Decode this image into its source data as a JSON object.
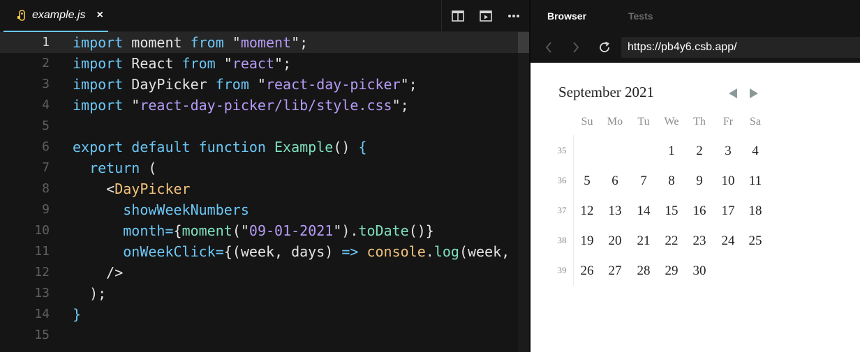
{
  "editor": {
    "tab": {
      "title": "example.js",
      "close": "×"
    },
    "toolbar_icons": [
      "split-view-icon",
      "preview-icon",
      "more-icon"
    ],
    "lines": [
      {
        "n": "1",
        "tokens": [
          {
            "t": "import",
            "c": "kw"
          },
          {
            "t": " moment ",
            "c": ""
          },
          {
            "t": "from",
            "c": "kw"
          },
          {
            "t": " \"",
            "c": "q"
          },
          {
            "t": "moment",
            "c": "str"
          },
          {
            "t": "\";",
            "c": "q"
          }
        ]
      },
      {
        "n": "2",
        "tokens": [
          {
            "t": "import",
            "c": "kw"
          },
          {
            "t": " React ",
            "c": ""
          },
          {
            "t": "from",
            "c": "kw"
          },
          {
            "t": " \"",
            "c": "q"
          },
          {
            "t": "react",
            "c": "str"
          },
          {
            "t": "\";",
            "c": "q"
          }
        ]
      },
      {
        "n": "3",
        "tokens": [
          {
            "t": "import",
            "c": "kw"
          },
          {
            "t": " DayPicker ",
            "c": ""
          },
          {
            "t": "from",
            "c": "kw"
          },
          {
            "t": " \"",
            "c": "q"
          },
          {
            "t": "react-day-picker",
            "c": "str"
          },
          {
            "t": "\";",
            "c": "q"
          }
        ]
      },
      {
        "n": "4",
        "tokens": [
          {
            "t": "import",
            "c": "kw"
          },
          {
            "t": " \"",
            "c": "q"
          },
          {
            "t": "react-day-picker/lib/style.css",
            "c": "str"
          },
          {
            "t": "\";",
            "c": "q"
          }
        ]
      },
      {
        "n": "5",
        "tokens": []
      },
      {
        "n": "6",
        "tokens": [
          {
            "t": "export",
            "c": "kw"
          },
          {
            "t": " ",
            "c": ""
          },
          {
            "t": "default",
            "c": "kw"
          },
          {
            "t": " ",
            "c": ""
          },
          {
            "t": "function",
            "c": "kw"
          },
          {
            "t": " ",
            "c": ""
          },
          {
            "t": "Example",
            "c": "fn"
          },
          {
            "t": "() ",
            "c": ""
          },
          {
            "t": "{",
            "c": "kw"
          }
        ]
      },
      {
        "n": "7",
        "tokens": [
          {
            "t": "  ",
            "c": ""
          },
          {
            "t": "return",
            "c": "kw"
          },
          {
            "t": " (",
            "c": ""
          }
        ]
      },
      {
        "n": "8",
        "tokens": [
          {
            "t": "    <",
            "c": ""
          },
          {
            "t": "DayPicker",
            "c": "tag"
          }
        ]
      },
      {
        "n": "9",
        "tokens": [
          {
            "t": "      ",
            "c": ""
          },
          {
            "t": "showWeekNumbers",
            "c": "attr"
          }
        ]
      },
      {
        "n": "10",
        "tokens": [
          {
            "t": "      ",
            "c": ""
          },
          {
            "t": "month",
            "c": "attr"
          },
          {
            "t": "=",
            "c": "kw"
          },
          {
            "t": "{",
            "c": ""
          },
          {
            "t": "moment",
            "c": "fn"
          },
          {
            "t": "(\"",
            "c": ""
          },
          {
            "t": "09-01-2021",
            "c": "str"
          },
          {
            "t": "\").",
            "c": ""
          },
          {
            "t": "toDate",
            "c": "fn"
          },
          {
            "t": "()}",
            "c": ""
          }
        ]
      },
      {
        "n": "11",
        "tokens": [
          {
            "t": "      ",
            "c": ""
          },
          {
            "t": "onWeekClick",
            "c": "attr"
          },
          {
            "t": "=",
            "c": "kw"
          },
          {
            "t": "{(week, days) ",
            "c": ""
          },
          {
            "t": "=>",
            "c": "kw"
          },
          {
            "t": " ",
            "c": ""
          },
          {
            "t": "console",
            "c": "cons"
          },
          {
            "t": ".",
            "c": ""
          },
          {
            "t": "log",
            "c": "fn"
          },
          {
            "t": "(week, da",
            "c": ""
          }
        ]
      },
      {
        "n": "12",
        "tokens": [
          {
            "t": "    />",
            "c": ""
          }
        ]
      },
      {
        "n": "13",
        "tokens": [
          {
            "t": "  );",
            "c": ""
          }
        ]
      },
      {
        "n": "14",
        "tokens": [
          {
            "t": "}",
            "c": "kw"
          }
        ]
      },
      {
        "n": "15",
        "tokens": []
      }
    ]
  },
  "browser": {
    "tabs": [
      {
        "label": "Browser",
        "active": true
      },
      {
        "label": "Tests",
        "active": false
      }
    ],
    "url": "https://pb4y6.csb.app/",
    "calendar": {
      "caption": "September 2021",
      "weekdays": [
        "Su",
        "Mo",
        "Tu",
        "We",
        "Th",
        "Fr",
        "Sa"
      ],
      "weeks": [
        {
          "num": "35",
          "days": [
            "",
            "",
            "",
            "1",
            "2",
            "3",
            "4"
          ]
        },
        {
          "num": "36",
          "days": [
            "5",
            "6",
            "7",
            "8",
            "9",
            "10",
            "11"
          ]
        },
        {
          "num": "37",
          "days": [
            "12",
            "13",
            "14",
            "15",
            "16",
            "17",
            "18"
          ]
        },
        {
          "num": "38",
          "days": [
            "19",
            "20",
            "21",
            "22",
            "23",
            "24",
            "25"
          ]
        },
        {
          "num": "39",
          "days": [
            "26",
            "27",
            "28",
            "29",
            "30",
            "",
            ""
          ]
        }
      ]
    }
  },
  "colors": {
    "accent": "#6cc7f6",
    "editor_bg": "#151515",
    "string": "#b59bf5",
    "function": "#7ee0c0",
    "tag": "#f2c27a"
  }
}
